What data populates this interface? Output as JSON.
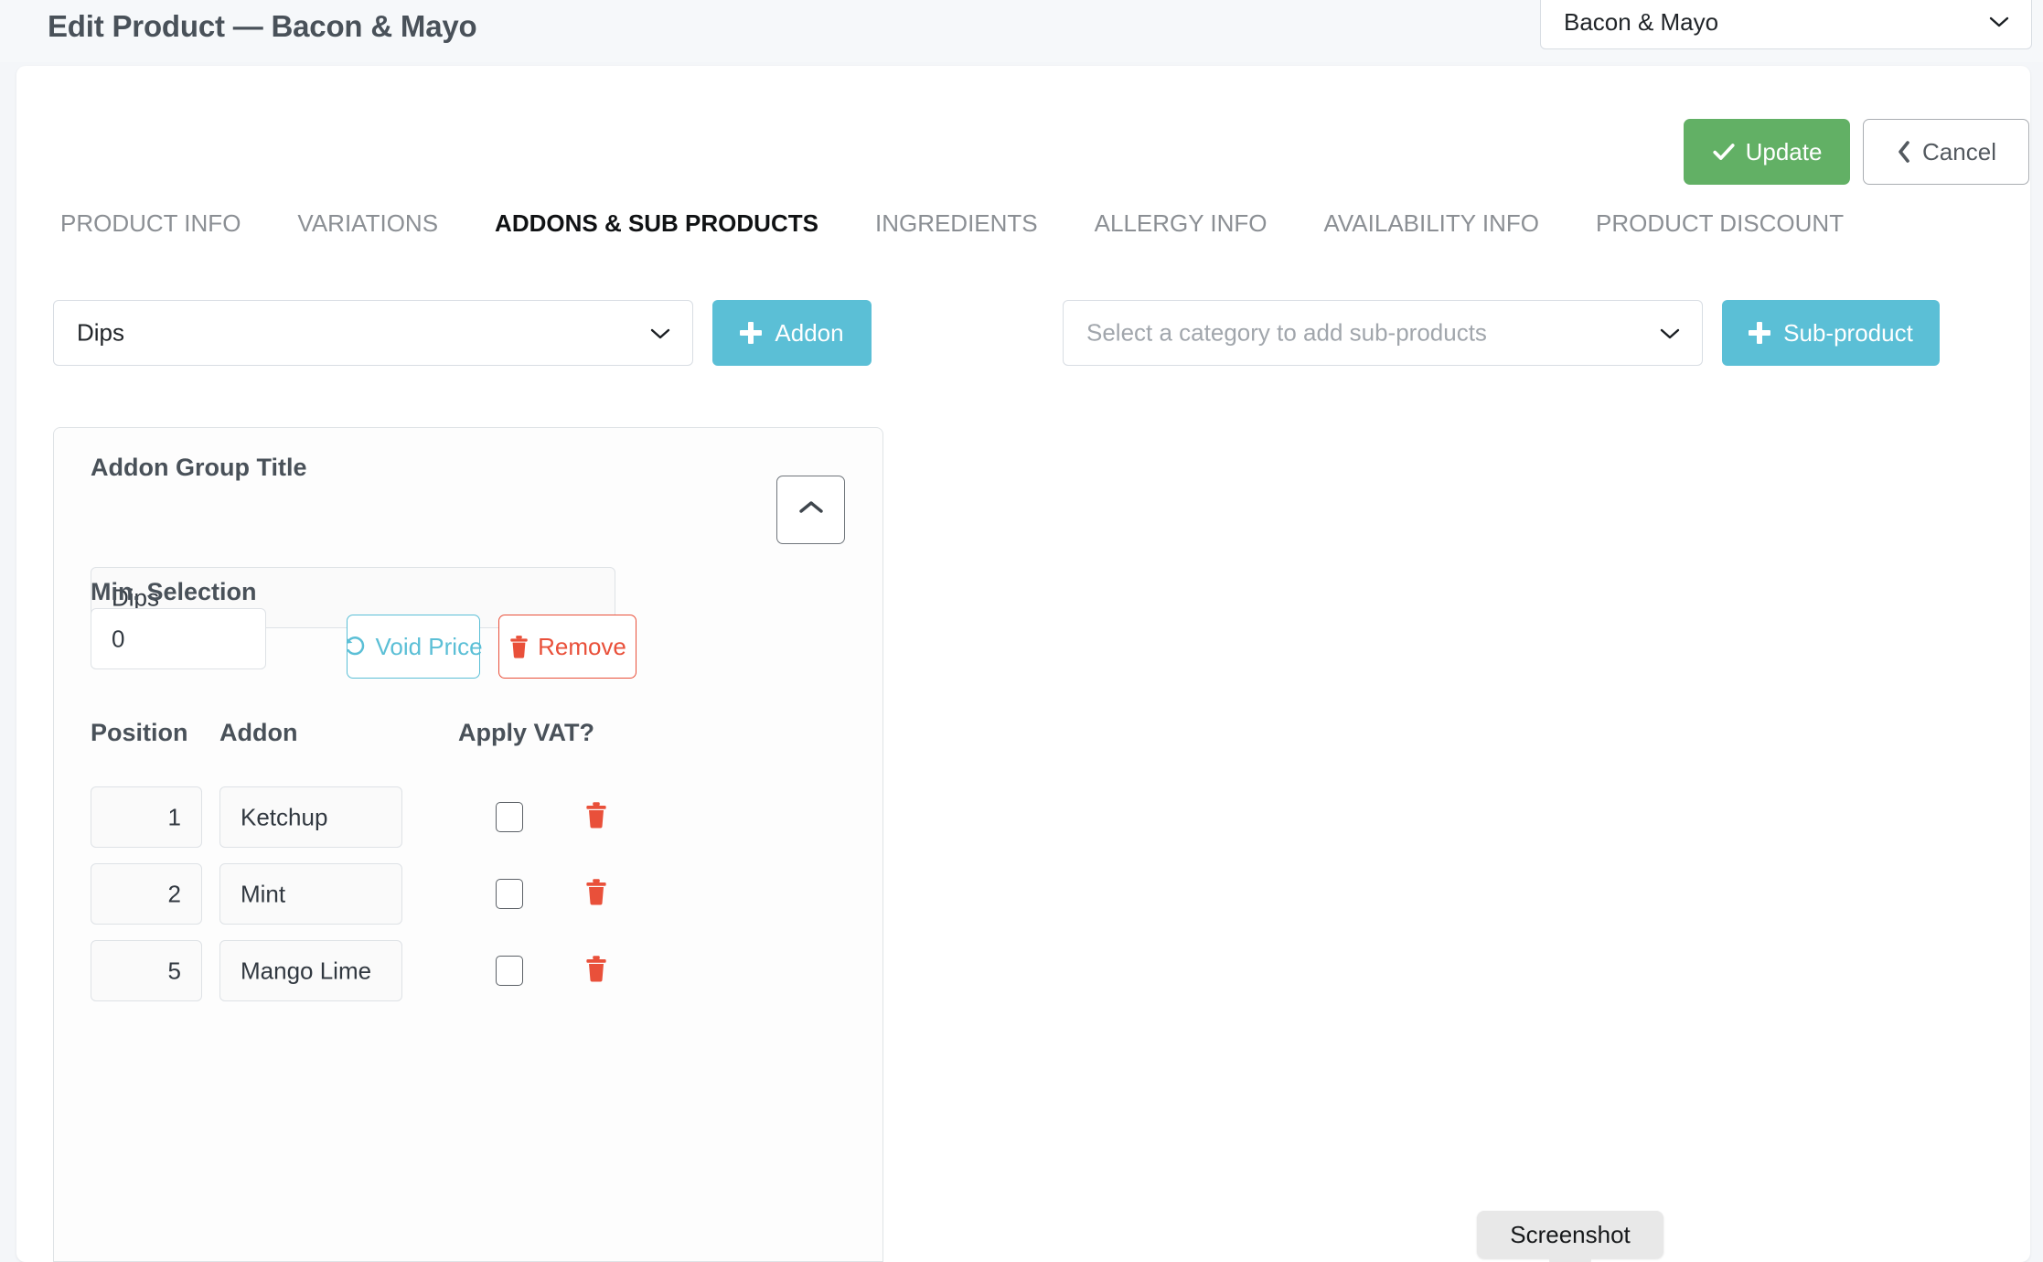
{
  "header": {
    "title": "Edit Product — Bacon & Mayo",
    "product_select_value": "Bacon & Mayo",
    "chevron_icon": "chevron-down-icon"
  },
  "actions": {
    "update_label": "Update",
    "update_icon": "check-icon",
    "cancel_label": "Cancel",
    "cancel_icon": "chevron-left-icon"
  },
  "tabs": [
    {
      "label": "PRODUCT INFO",
      "active": false
    },
    {
      "label": "VARIATIONS",
      "active": false
    },
    {
      "label": "ADDONS & SUB PRODUCTS",
      "active": true
    },
    {
      "label": "INGREDIENTS",
      "active": false
    },
    {
      "label": "ALLERGY INFO",
      "active": false
    },
    {
      "label": "AVAILABILITY INFO",
      "active": false
    },
    {
      "label": "PRODUCT DISCOUNT",
      "active": false
    }
  ],
  "toolbar": {
    "addon_category_value": "Dips",
    "addon_button_label": "Addon",
    "subproduct_category_placeholder": "Select a category to add sub-products",
    "subproduct_button_label": "Sub-product",
    "plus_icon": "plus-icon",
    "chevron_icon": "chevron-down-icon"
  },
  "addon_group": {
    "title_label": "Addon Group Title",
    "title_value": "Dips",
    "collapse_icon": "chevron-up-icon",
    "min_selection_label": "Min. Selection",
    "min_selection_value": "0",
    "void_price_label": "Void Price",
    "void_price_icon": "undo-icon",
    "remove_label": "Remove",
    "remove_icon": "trash-icon",
    "columns": {
      "position": "Position",
      "addon": "Addon",
      "vat": "Apply VAT?"
    },
    "rows": [
      {
        "position": "1",
        "addon": "Ketchup",
        "vat_checked": false,
        "delete_icon": "trash-icon"
      },
      {
        "position": "2",
        "addon": "Mint",
        "vat_checked": false,
        "delete_icon": "trash-icon"
      },
      {
        "position": "5",
        "addon": "Mango Lime",
        "vat_checked": false,
        "delete_icon": "trash-icon"
      }
    ]
  },
  "overlay": {
    "screenshot_tooltip": "Screenshot"
  },
  "colors": {
    "update_green": "#62b065",
    "teal": "#5bbfd6",
    "danger_red": "#e9503a",
    "title_slate": "#495159",
    "page_bg": "#f4f6f9"
  }
}
